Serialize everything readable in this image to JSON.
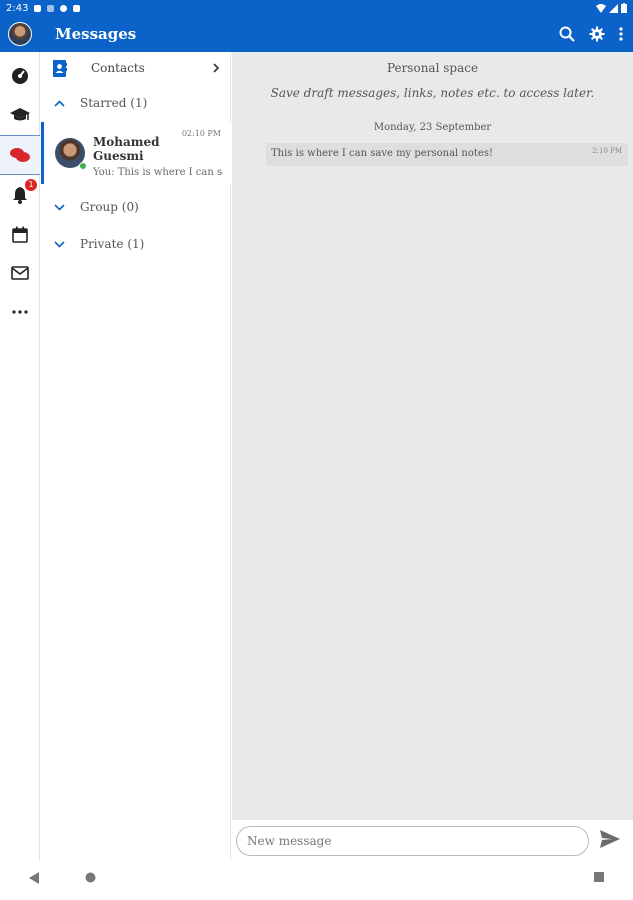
{
  "status_bar": {
    "time": "2:43"
  },
  "app_bar": {
    "title": "Messages"
  },
  "rail": {
    "items": [
      {
        "icon": "dashboard-icon"
      },
      {
        "icon": "graduation-cap-icon"
      },
      {
        "icon": "chat-icon",
        "active": true
      },
      {
        "icon": "bell-icon",
        "badge": "1"
      },
      {
        "icon": "calendar-icon"
      },
      {
        "icon": "mail-icon"
      },
      {
        "icon": "more-horizontal-icon"
      }
    ]
  },
  "list": {
    "contacts_label": "Contacts",
    "sections": {
      "starred": "Starred (1)",
      "group": "Group (0)",
      "private": "Private (1)"
    },
    "conversation": {
      "name": "Mohamed Guesmi",
      "time": "02:10 PM",
      "preview": "You: This is where I can sav"
    }
  },
  "main": {
    "personal_space_title": "Personal space",
    "personal_space_subtitle": "Save draft messages, links, notes etc. to access later.",
    "date_divider": "Monday, 23 September",
    "messages": [
      {
        "text": "This is where I can save my personal notes!",
        "time": "2:10 PM"
      }
    ]
  },
  "composer": {
    "placeholder": "New message"
  },
  "colors": {
    "primary": "#0b63c9",
    "online": "#3cb043",
    "badge": "#e02424",
    "chat_bg": "#e8e9eb"
  }
}
